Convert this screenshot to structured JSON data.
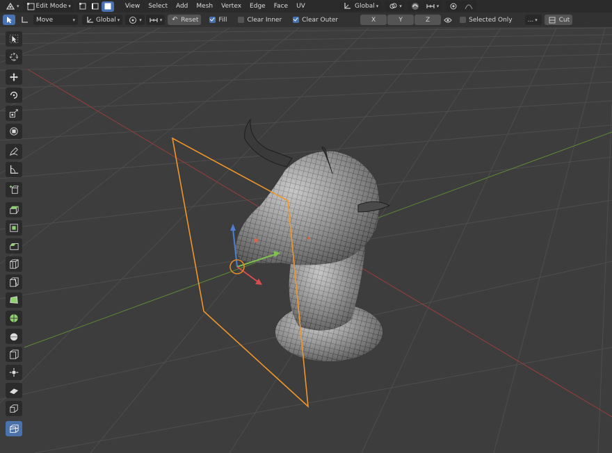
{
  "header": {
    "mode": "Edit Mode",
    "menus": [
      "View",
      "Select",
      "Add",
      "Mesh",
      "Vertex",
      "Edge",
      "Face",
      "UV"
    ],
    "transform_orientation": "Global"
  },
  "tool_settings": {
    "tool": "Move",
    "orientation": "Global",
    "reset_label": "Reset",
    "fill": {
      "label": "Fill",
      "checked": true
    },
    "clear_inner": {
      "label": "Clear Inner",
      "checked": false
    },
    "clear_outer": {
      "label": "Clear Outer",
      "checked": true
    },
    "axis_x": "X",
    "axis_y": "Y",
    "axis_z": "Z",
    "selected_only": {
      "label": "Selected Only",
      "checked": false
    },
    "threshold_value": "...",
    "cut_label": "Cut"
  },
  "toolbar_icons": [
    "select-box-icon",
    "cursor-icon",
    "move-icon",
    "rotate-icon",
    "scale-icon",
    "transform-icon",
    "annotate-icon",
    "measure-icon",
    "add-cube-icon",
    "extrude-icon",
    "inset-icon",
    "bevel-icon",
    "loop-cut-icon",
    "knife-icon",
    "poly-build-icon",
    "spin-icon",
    "smooth-icon",
    "edge-slide-icon",
    "shrink-fatten-icon",
    "shear-icon",
    "rip-icon",
    "bisect-icon"
  ],
  "colors": {
    "accent": "#4772b3",
    "active_tool": "#4a72ad",
    "bisect_plane": "#f0962a",
    "x_axis": "#b3403e",
    "y_axis": "#6e9a3a",
    "grid": "#4f4f4f",
    "background": "#3d3d3d"
  }
}
